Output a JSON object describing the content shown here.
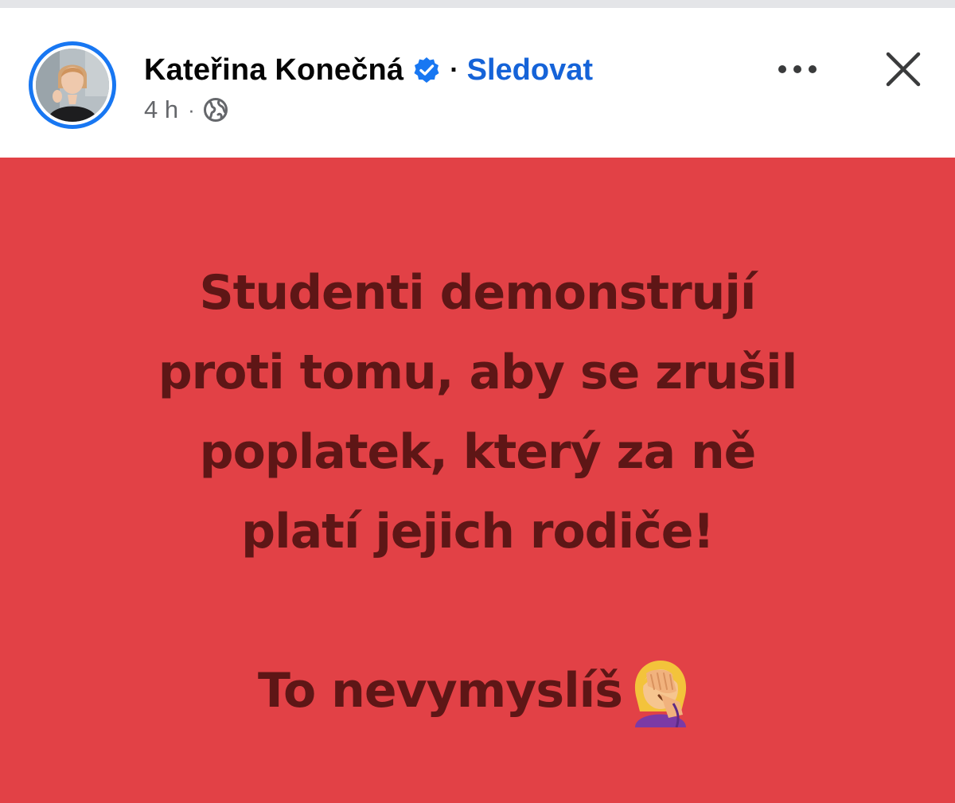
{
  "post": {
    "author": {
      "name": "Kateřina Konečná",
      "verified_icon": "verified-badge-icon",
      "follow_label": "Sledovat",
      "separator": "·"
    },
    "meta": {
      "timestamp": "4 h",
      "separator": "·",
      "audience_icon": "globe-icon"
    },
    "actions": {
      "more_icon": "more-dots-icon",
      "close_icon": "close-icon"
    },
    "content": {
      "lines": [
        "Studenti demonstrují",
        "proti tomu, aby se zrušil",
        "poplatek, který za ně",
        "platí jejich rodiče!"
      ],
      "closing": "To nevymyslíš",
      "closing_emoji": "woman-facepalming-emoji"
    }
  },
  "colors": {
    "accent_blue": "#1877f2",
    "link_blue": "#1563d8",
    "post_background": "#e24146",
    "post_text": "#5e1616",
    "meta_grey": "#65676b"
  }
}
